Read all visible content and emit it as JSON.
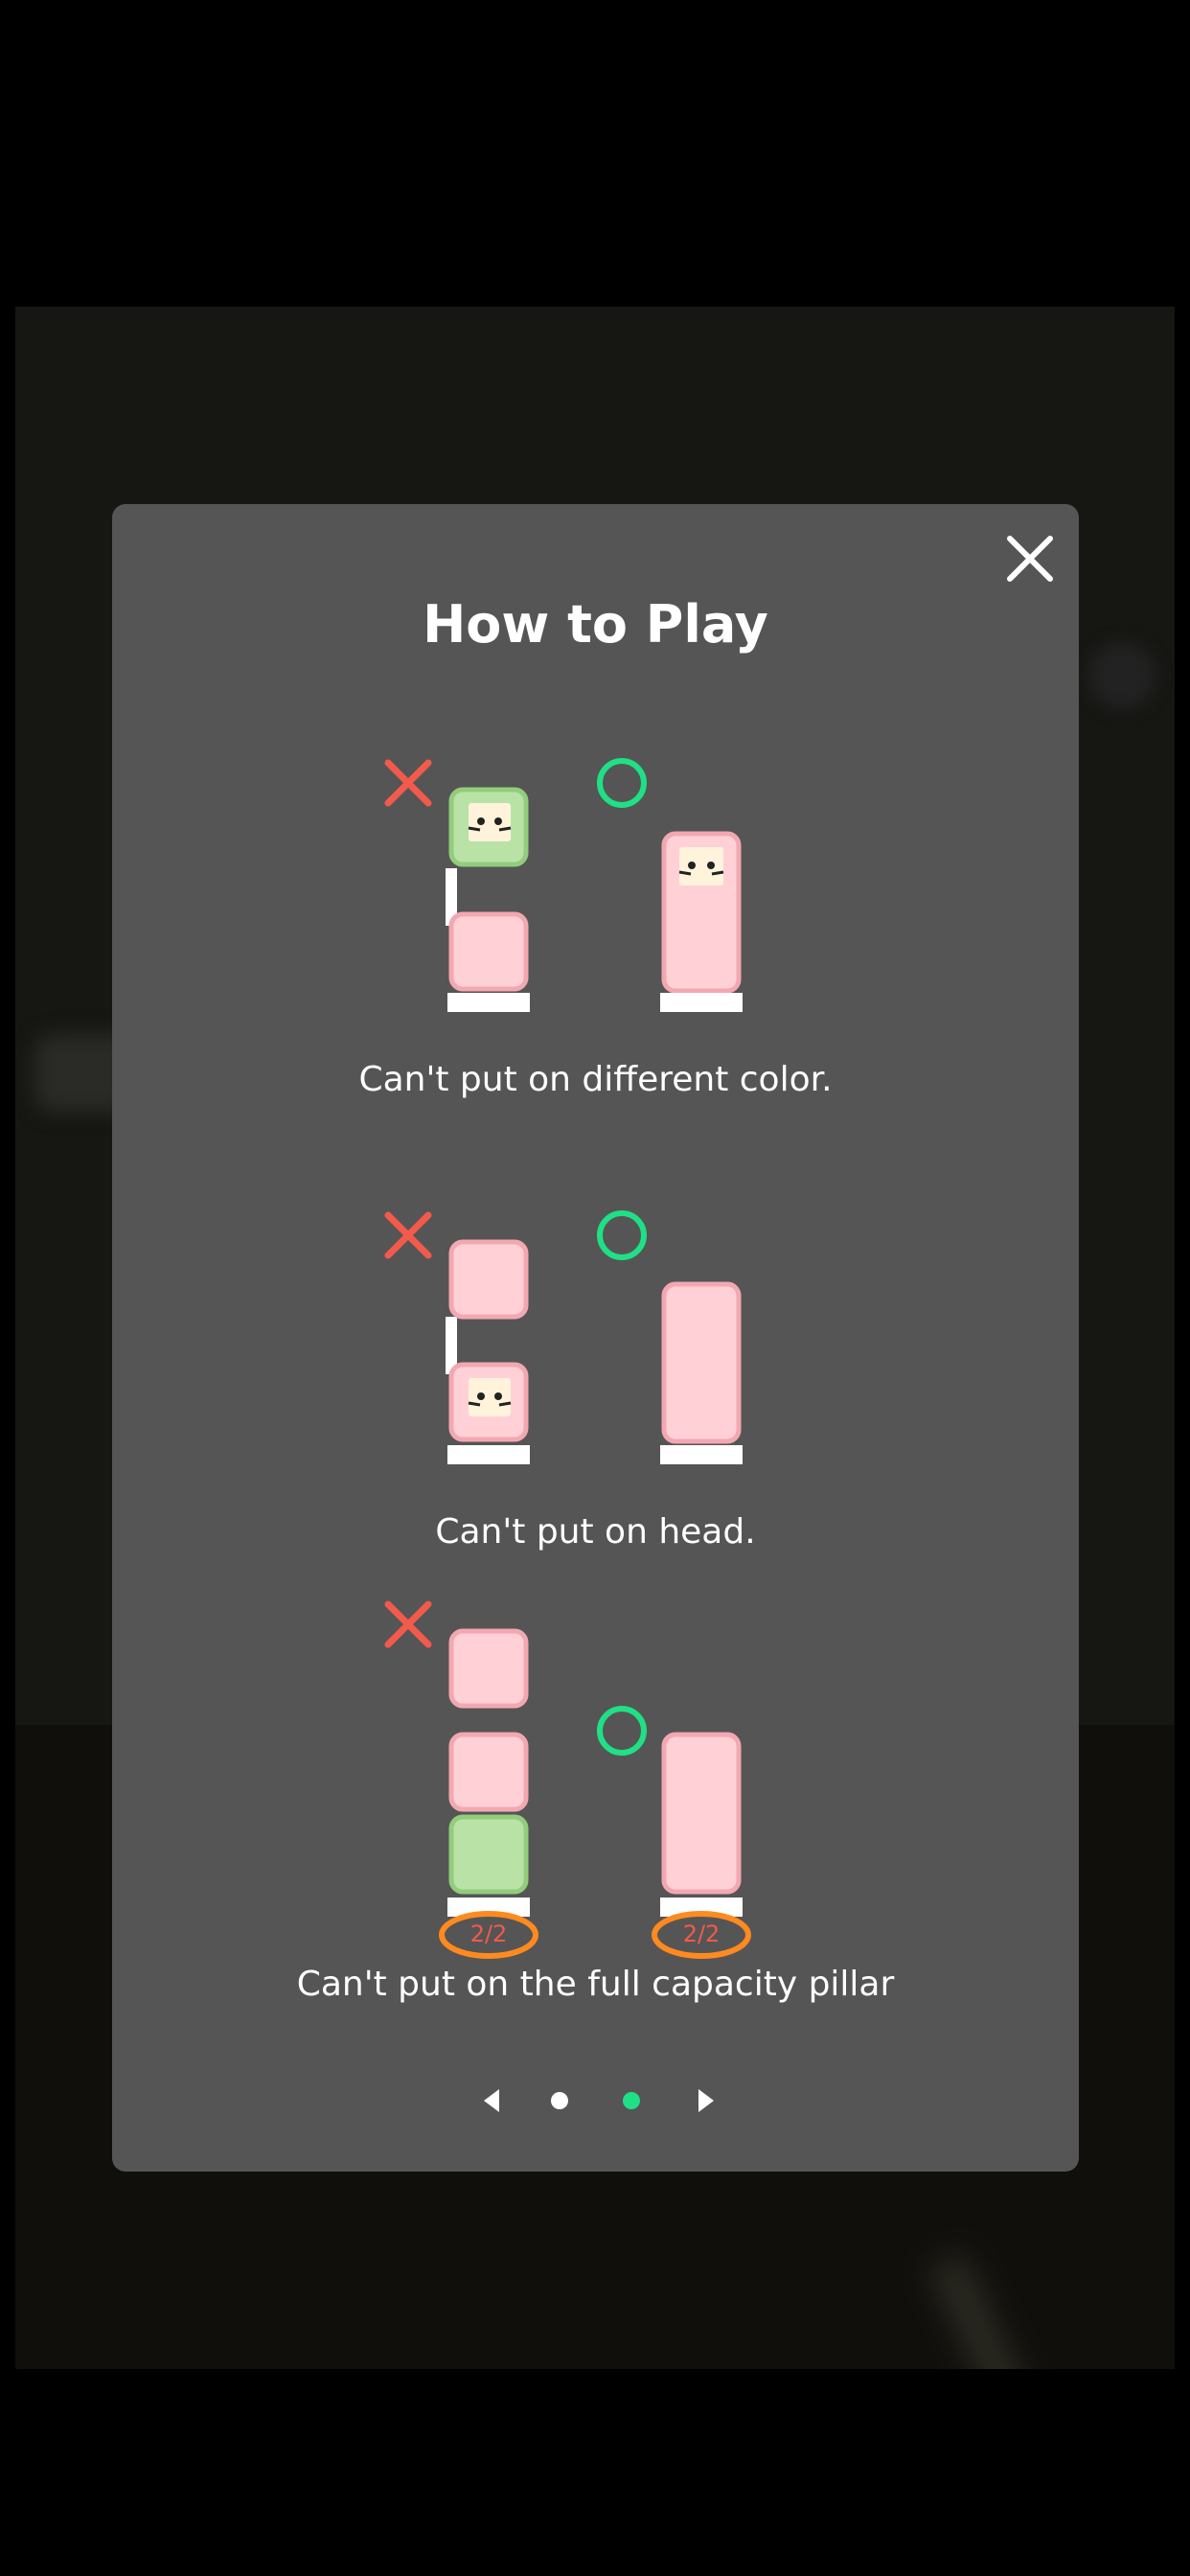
{
  "dialog": {
    "title": "How to Play",
    "close_icon": "close-icon"
  },
  "rules": [
    {
      "caption": "Can't put on different color.",
      "wrong_icon": "cross-icon",
      "right_icon": "circle-icon"
    },
    {
      "caption": "Can't put on head.",
      "wrong_icon": "cross-icon",
      "right_icon": "circle-icon"
    },
    {
      "caption": "Can't put on the full capacity pillar",
      "wrong_icon": "cross-icon",
      "right_icon": "circle-icon",
      "capacity_wrong": "2/2",
      "capacity_right": "2/2"
    }
  ],
  "pagination": {
    "prev_icon": "chevron-left-icon",
    "next_icon": "chevron-right-icon",
    "pages": 2,
    "current_page": 2
  },
  "colors": {
    "modal_bg": "#555555",
    "pink": "#ffd1d6",
    "pink_border": "#f3a8b1",
    "green": "#b9e3a6",
    "green_border": "#93cc7c",
    "wrong": "#f25a4b",
    "right": "#1fe085",
    "capacity_ring": "#ff8a1f",
    "dot_active": "#1fe085",
    "dot_inactive": "#ffffff"
  }
}
